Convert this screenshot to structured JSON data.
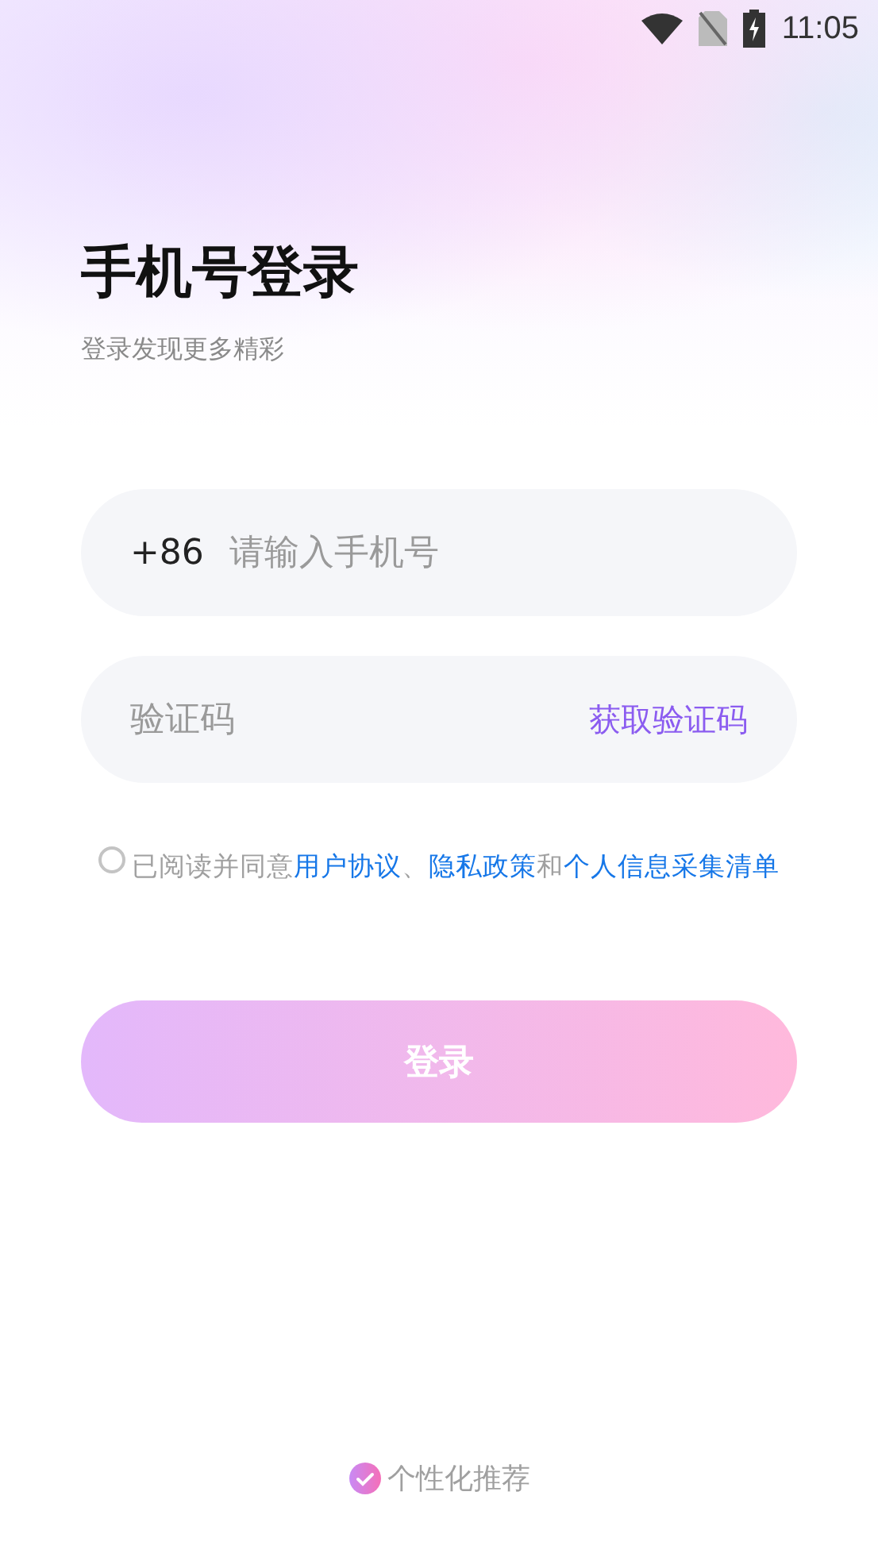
{
  "status_bar": {
    "time": "11:05"
  },
  "header": {
    "title": "手机号登录",
    "subtitle": "登录发现更多精彩"
  },
  "phone_field": {
    "country_code": "+86",
    "placeholder": "请输入手机号"
  },
  "code_field": {
    "placeholder": "验证码",
    "action": "获取验证码"
  },
  "agreement": {
    "checked": false,
    "parts": [
      {
        "kind": "text",
        "text": "已阅读并同意"
      },
      {
        "kind": "link",
        "text": "用户协议"
      },
      {
        "kind": "text",
        "text": "、"
      },
      {
        "kind": "link",
        "text": "隐私政策"
      },
      {
        "kind": "text",
        "text": "和"
      },
      {
        "kind": "link",
        "text": "个人信息采集清单"
      }
    ]
  },
  "login_button": {
    "label": "登录",
    "disabled": true
  },
  "recommendation": {
    "label": "个性化推荐",
    "checked": true
  }
}
